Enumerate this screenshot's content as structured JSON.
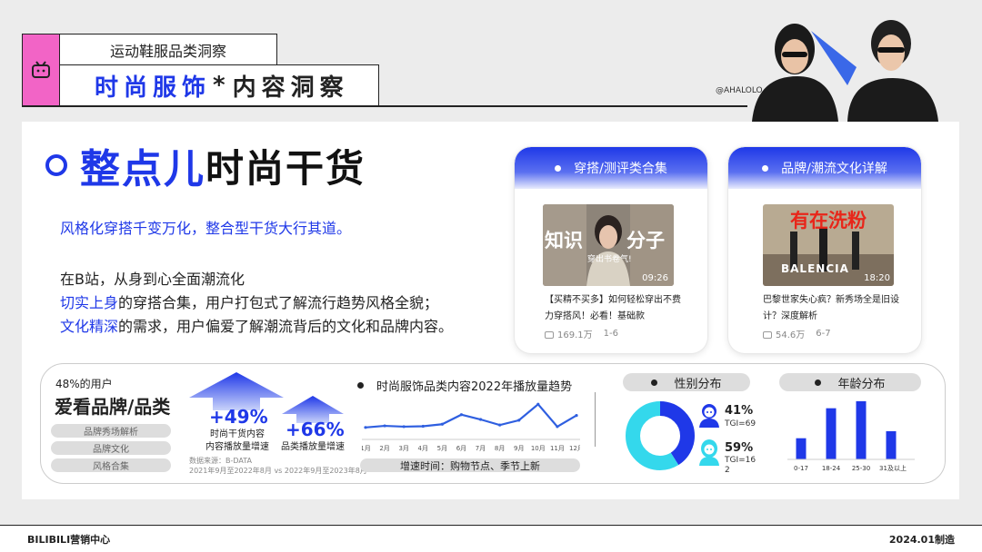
{
  "header": {
    "subtitle": "运动鞋服品类洞察",
    "title_part1": "时尚服饰",
    "title_star": "*",
    "title_part2": "内容洞察",
    "credit": "@AHALOLO"
  },
  "main": {
    "title_blue": "整点儿",
    "title_black": "时尚干货",
    "lead": "风格化穿搭千变万化，整合型干货大行其道。",
    "line1": "在B站，从身到心全面潮流化",
    "line2_hl": "切实上身",
    "line2_rest": "的穿搭合集，用户打包式了解流行趋势风格全貌；",
    "line3_hl": "文化精深",
    "line3_rest": "的需求，用户偏爱了解潮流背后的文化和品牌内容。"
  },
  "cards": [
    {
      "title": "穿搭/测评类合集",
      "thumb_text_left": "知识",
      "thumb_text_right": "分子",
      "thumb_sub": "穿出书卷气!",
      "duration": "09:26",
      "caption": "【买精不买多】如何轻松穿出不费力穿搭风！必看！基础款",
      "views": "169.1万",
      "episodes": "1-6"
    },
    {
      "title": "品牌/潮流文化详解",
      "thumb_text": "有在洗粉",
      "thumb_brand": "BALENCIA",
      "duration": "18:20",
      "caption": "巴黎世家失心疯？新秀场全是旧设计？深度解析",
      "views": "54.6万",
      "episodes": "6-7"
    }
  ],
  "stats": {
    "share_label": "48%的用户",
    "share_title": "爱看品牌/品类",
    "pills": [
      "品牌秀场解析",
      "品牌文化",
      "风格合集"
    ],
    "growth1_value": "+49%",
    "growth1_label_1": "时尚干货内容",
    "growth1_label_2": "内容播放量增速",
    "growth2_value": "+66%",
    "growth2_label": "品类播放量增速",
    "source_1": "数据来源：B-DATA",
    "source_2": "2021年9月至2022年8月 vs 2022年9月至2023年8月"
  },
  "trend": {
    "title": "时尚服饰品类内容2022年播放量趋势",
    "note": "增速时间：购物节点、季节上新"
  },
  "gender": {
    "title": "性别分布",
    "male_pct": "41%",
    "male_tgi": "TGI=69",
    "female_pct": "59%",
    "female_tgi_1": "TGI=16",
    "female_tgi_2": "2"
  },
  "age": {
    "title": "年龄分布"
  },
  "chart_data": [
    {
      "type": "line",
      "title": "时尚服饰品类内容2022年播放量趋势",
      "categories": [
        "1月",
        "2月",
        "3月",
        "4月",
        "5月",
        "6月",
        "7月",
        "8月",
        "9月",
        "10月",
        "11月",
        "12月"
      ],
      "values": [
        30,
        34,
        32,
        33,
        38,
        62,
        50,
        36,
        48,
        88,
        32,
        60
      ],
      "ylim": [
        0,
        100
      ],
      "color": "#2f5fe0"
    },
    {
      "type": "pie",
      "title": "性别分布",
      "labels": [
        "男",
        "女"
      ],
      "values": [
        41,
        59
      ],
      "colors": [
        "#1f38e8",
        "#34d8ec"
      ]
    },
    {
      "type": "bar",
      "title": "年龄分布",
      "categories": [
        "0-17",
        "18-24",
        "25-30",
        "31及以上"
      ],
      "values": [
        24,
        58,
        66,
        32
      ],
      "ylim": [
        0,
        70
      ],
      "color": "#1f38e8"
    }
  ],
  "footer": {
    "left": "BILIBILI营销中心",
    "right": "2024.01制造"
  },
  "colors": {
    "accent": "#1f38e8",
    "pink": "#f264c6",
    "cyan": "#34d8ec"
  }
}
